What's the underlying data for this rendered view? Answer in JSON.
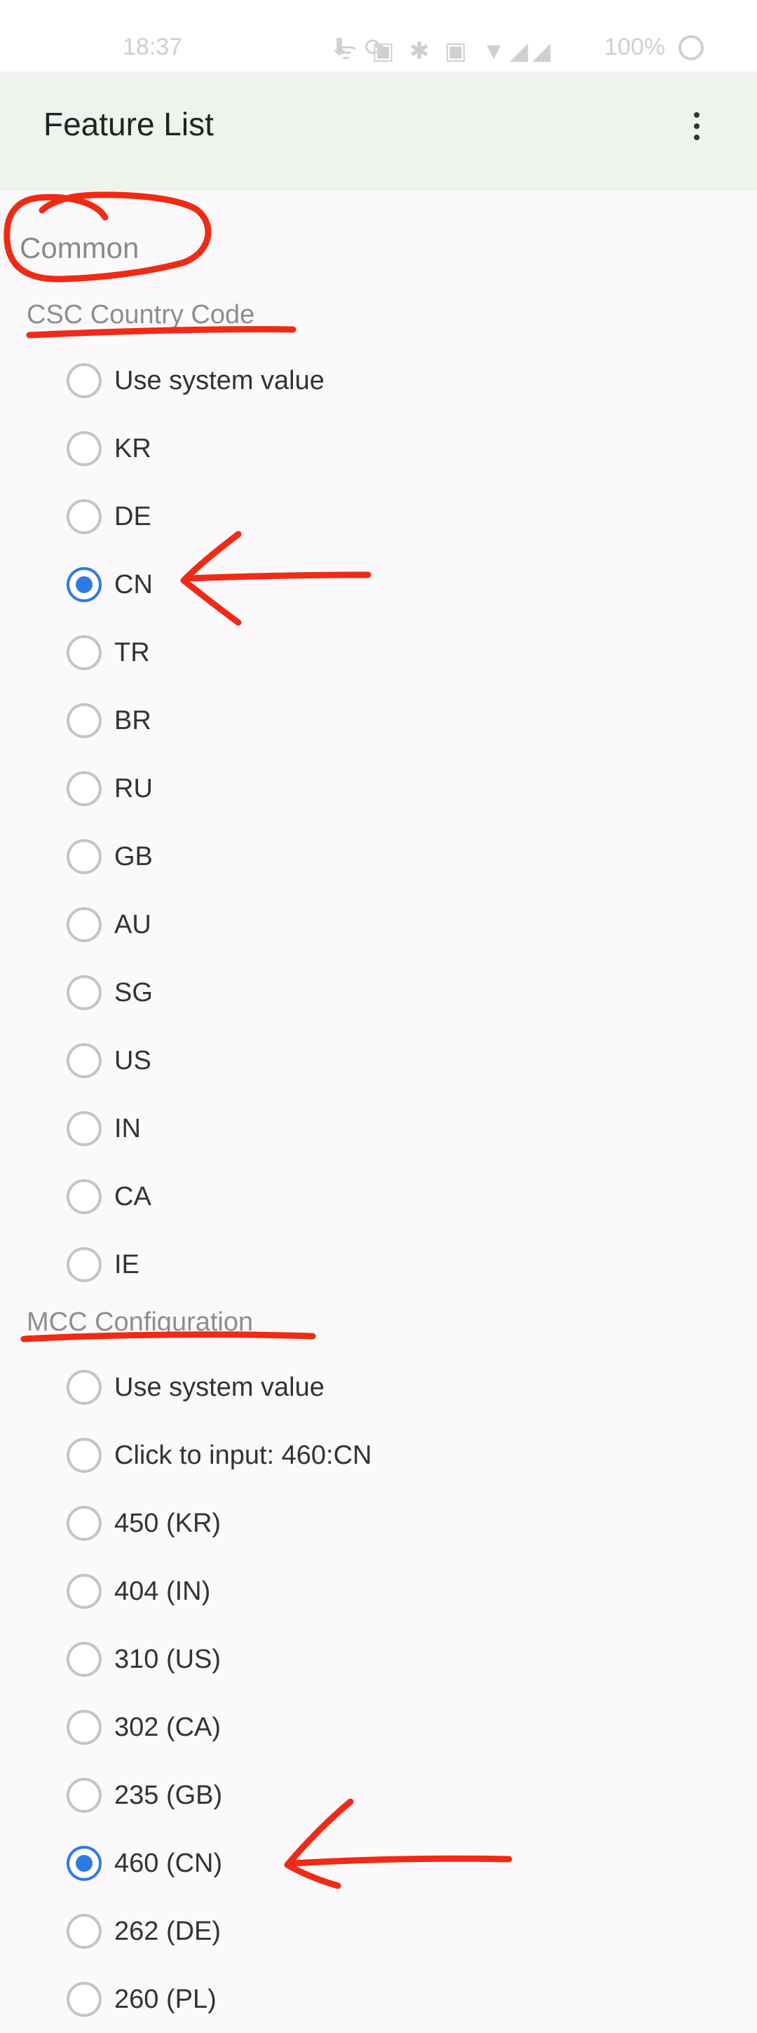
{
  "status_bar": {
    "time": "18:37",
    "left_icons": "⬇ ⟳",
    "right_icons": "ᯤ ▣ ✱ ▣ ▼◢◢",
    "battery": "100%"
  },
  "app_bar": {
    "title": "Feature List",
    "more_icon": "more-vert-icon"
  },
  "section": {
    "title": "Common"
  },
  "groups": {
    "csc": {
      "title": "CSC Country Code",
      "options": [
        "Use system value",
        "KR",
        "DE",
        "CN",
        "TR",
        "BR",
        "RU",
        "GB",
        "AU",
        "SG",
        "US",
        "IN",
        "CA",
        "IE"
      ],
      "selected": "CN"
    },
    "mcc": {
      "title": "MCC Configuration",
      "options": [
        "Use system value",
        "Click to input: 460:CN",
        "450 (KR)",
        "404 (IN)",
        "310 (US)",
        "302 (CA)",
        "235 (GB)",
        "460 (CN)",
        "262 (DE)",
        "260 (PL)"
      ],
      "selected": "460 (CN)"
    }
  },
  "colors": {
    "accent": "#2d7ae5",
    "annotation": "#f02a14",
    "app_bar_bg": "#eef3ee"
  }
}
